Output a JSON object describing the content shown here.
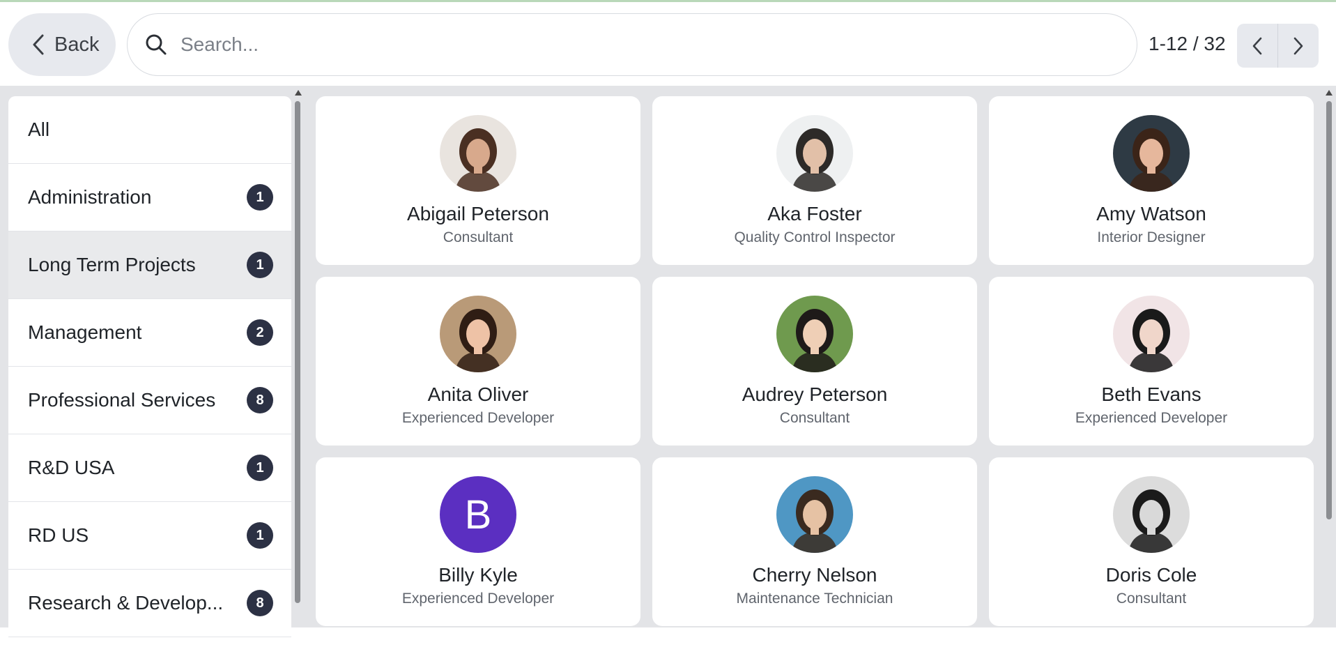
{
  "header": {
    "back_label": "Back",
    "search_placeholder": "Search...",
    "pager_text": "1-12 / 32"
  },
  "sidebar": {
    "items": [
      {
        "label": "All",
        "count": ""
      },
      {
        "label": "Administration",
        "count": "1"
      },
      {
        "label": "Long Term Projects",
        "count": "1",
        "active": true
      },
      {
        "label": "Management",
        "count": "2"
      },
      {
        "label": "Professional Services",
        "count": "8"
      },
      {
        "label": "R&D USA",
        "count": "1"
      },
      {
        "label": "RD US",
        "count": "1"
      },
      {
        "label": "Research & Develop...",
        "count": "8"
      }
    ]
  },
  "cards": [
    {
      "name": "Abigail Peterson",
      "role": "Consultant",
      "avatar": "photo",
      "bg": "#e9e4df",
      "hair": "#4a2f22",
      "skin": "#d8a98c"
    },
    {
      "name": "Aka Foster",
      "role": "Quality Control Inspector",
      "avatar": "photo",
      "bg": "#eef0f1",
      "hair": "#2d2a28",
      "skin": "#e2c0a8"
    },
    {
      "name": "Amy Watson",
      "role": "Interior Designer",
      "avatar": "photo",
      "bg": "#2e3a44",
      "hair": "#3b2418",
      "skin": "#e6b79c"
    },
    {
      "name": "Anita Oliver",
      "role": "Experienced Developer",
      "avatar": "photo",
      "bg": "#b99a78",
      "hair": "#2f1d14",
      "skin": "#eec2a6"
    },
    {
      "name": "Audrey Peterson",
      "role": "Consultant",
      "avatar": "photo",
      "bg": "#6f9a4e",
      "hair": "#1e1a19",
      "skin": "#efcfb6"
    },
    {
      "name": "Beth Evans",
      "role": "Experienced Developer",
      "avatar": "photo",
      "bg": "#f1e4e6",
      "hair": "#1a1a1a",
      "skin": "#f0d6ca"
    },
    {
      "name": "Billy Kyle",
      "role": "Experienced Developer",
      "avatar": "letter",
      "letter": "B",
      "bg": "#5b2fc1"
    },
    {
      "name": "Cherry Nelson",
      "role": "Maintenance Technician",
      "avatar": "photo",
      "bg": "#4f97c4",
      "hair": "#3a2a1f",
      "skin": "#e6c2a4"
    },
    {
      "name": "Doris Cole",
      "role": "Consultant",
      "avatar": "photo",
      "bg": "#dcdcdc",
      "hair": "#1b1b1b",
      "skin": "#d9d9d9"
    }
  ]
}
